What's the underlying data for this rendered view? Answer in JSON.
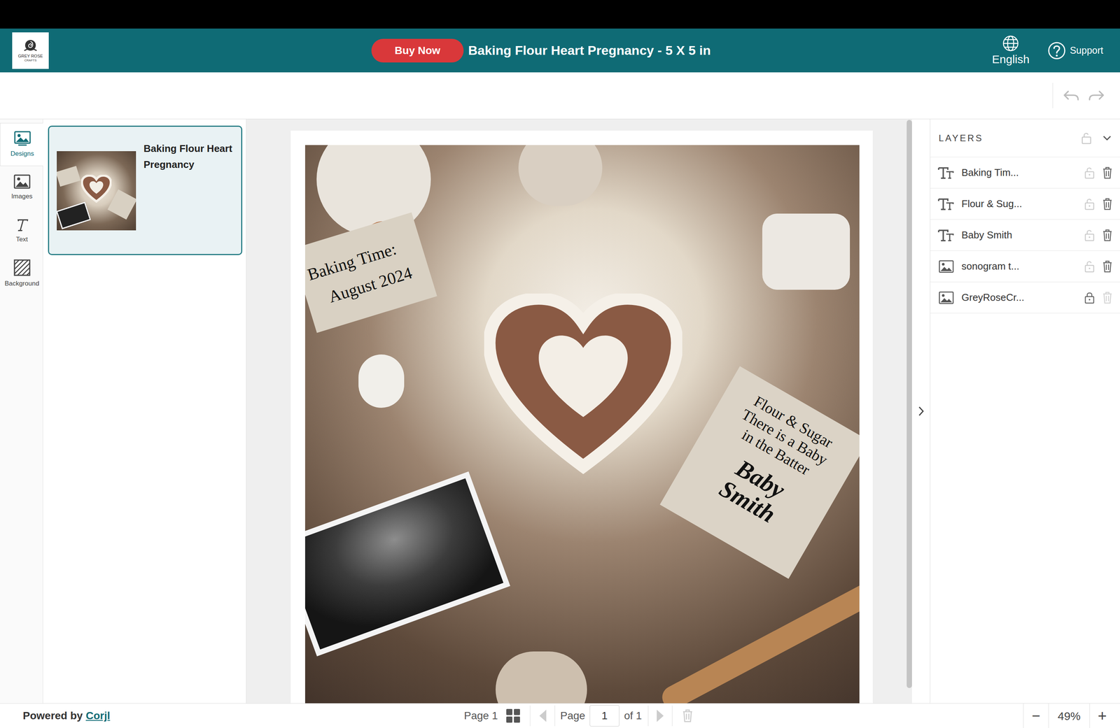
{
  "header": {
    "logo": [
      "GREY ROSE",
      "CRAFTS"
    ],
    "buy_button": "Buy Now",
    "title": "Baking Flour Heart Pregnancy - 5 X 5 in",
    "language": "English",
    "support": "Support"
  },
  "toolbar": {
    "undo_disabled": true,
    "redo_disabled": true
  },
  "rail": [
    {
      "label": "Designs",
      "selected": true
    },
    {
      "label": "Images",
      "selected": false
    },
    {
      "label": "Text",
      "selected": false
    },
    {
      "label": "Background",
      "selected": false
    }
  ],
  "designs": [
    {
      "title": "Baking Flour Heart Pregnancy",
      "selected": true
    }
  ],
  "canvas": {
    "date_card": [
      "Baking Time:",
      "August 2024"
    ],
    "verse_card": [
      "Flour & Sugar",
      "There is a Baby",
      "in the Batter"
    ],
    "name": [
      "Baby",
      "Smith"
    ]
  },
  "layers": {
    "title": "LAYERS",
    "items": [
      {
        "label": "Baking Tim...",
        "kind": "text",
        "locked": false
      },
      {
        "label": "Flour & Sug...",
        "kind": "text",
        "locked": false
      },
      {
        "label": "Baby Smith",
        "kind": "text",
        "locked": false
      },
      {
        "label": "sonogram t...",
        "kind": "image",
        "locked": false
      },
      {
        "label": "GreyRoseCr...",
        "kind": "image",
        "locked": true
      }
    ]
  },
  "footer": {
    "powered_by": "Powered by",
    "brand": "Corjl",
    "page_label": "Page 1",
    "page_word": "Page",
    "page_value": "1",
    "page_of": "of 1",
    "zoom_out": "−",
    "zoom": "49%",
    "zoom_in": "+"
  }
}
